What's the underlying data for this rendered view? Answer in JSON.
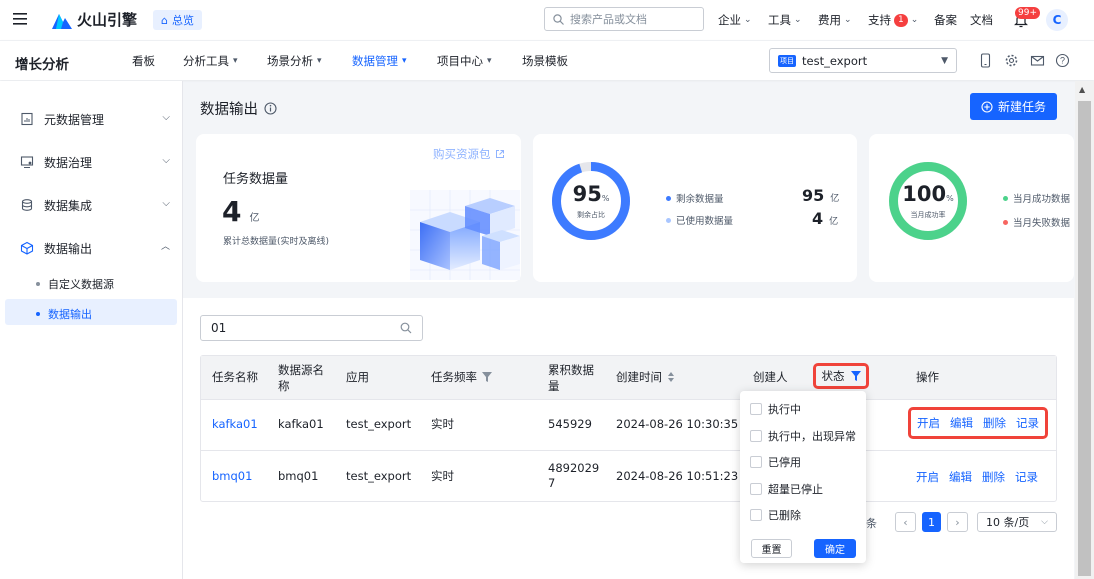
{
  "topbar": {
    "brand": "火山引擎",
    "home_chip": "总览",
    "search_placeholder": "搜索产品或文档",
    "nav": [
      {
        "label": "企业",
        "caret": "⌄"
      },
      {
        "label": "工具",
        "caret": "⌄"
      },
      {
        "label": "费用",
        "caret": "⌄"
      },
      {
        "label": "支持",
        "badge": "1",
        "caret": "⌄"
      },
      {
        "label": "备案"
      },
      {
        "label": "文档"
      }
    ],
    "notifications_badge": "99+",
    "avatar_initial": "C"
  },
  "subnav": {
    "app_title": "增长分析",
    "tabs": [
      {
        "label": "看板"
      },
      {
        "label": "分析工具"
      },
      {
        "label": "场景分析"
      },
      {
        "label": "数据管理"
      },
      {
        "label": "项目中心"
      },
      {
        "label": "场景模板"
      }
    ],
    "project_tag": "项目",
    "project_name": "test_export"
  },
  "sidebar": {
    "items": [
      {
        "label": "元数据管理",
        "icon": "chart-doc-icon"
      },
      {
        "label": "数据治理",
        "icon": "monitor-icon"
      },
      {
        "label": "数据集成",
        "icon": "database-icon"
      },
      {
        "label": "数据输出",
        "icon": "cube-icon"
      }
    ],
    "sub_items": [
      {
        "label": "自定义数据源"
      },
      {
        "label": "数据输出"
      }
    ]
  },
  "main": {
    "title": "数据输出",
    "new_task_label": "新建任务",
    "card1": {
      "buy_link": "购买资源包",
      "label": "任务数据量",
      "value": "4",
      "unit": "亿",
      "desc": "累计总数据量(实时及离线)"
    },
    "card2": {
      "ring_value": "95",
      "ring_unit": "%",
      "ring_label": "剩余占比",
      "ring_fraction": 0.95,
      "rows": [
        {
          "label": "剩余数据量",
          "value": "95",
          "unit": "亿"
        },
        {
          "label": "已使用数据量",
          "value": "4",
          "unit": "亿"
        }
      ]
    },
    "card3": {
      "ring_value": "100",
      "ring_unit": "%",
      "ring_label": "当月成功率",
      "ring_fraction": 1.0,
      "rows": [
        {
          "label": "当月成功数据"
        },
        {
          "label": "当月失败数据"
        }
      ]
    },
    "filter_value": "01",
    "table": {
      "headers": {
        "name": "任务名称",
        "source_l1": "数据源名",
        "source_l2": "称",
        "app": "应用",
        "freq": "任务频率",
        "total_l1": "累积数据",
        "total_l2": "量",
        "created": "创建时间",
        "creator": "创建人",
        "status": "状态",
        "ops": "操作"
      },
      "rows": [
        {
          "name": "kafka01",
          "source": "kafka01",
          "app": "test_export",
          "freq": "实时",
          "total_l1": "545929",
          "total_l2": "",
          "created": "2024-08-26 10:30:35",
          "ops": [
            "开启",
            "编辑",
            "删除",
            "记录"
          ]
        },
        {
          "name": "bmq01",
          "source": "bmq01",
          "app": "test_export",
          "freq": "实时",
          "total_l1": "4892029",
          "total_l2": "7",
          "created": "2024-08-26 10:51:23",
          "ops": [
            "开启",
            "编辑",
            "删除",
            "记录"
          ]
        }
      ]
    },
    "status_dropdown": {
      "options": [
        "执行中",
        "执行中，出现异常",
        "已停用",
        "超量已停止",
        "已删除"
      ],
      "reset_label": "重置",
      "ok_label": "确定"
    },
    "pagination": {
      "total_suffix": "条",
      "current_page": "1",
      "page_size": "10 条/页"
    }
  },
  "colors": {
    "primary": "#1664ff",
    "ring_blue": "#3d7bff",
    "ring_green": "#4cd28b",
    "highlight_red": "#f0433a"
  }
}
